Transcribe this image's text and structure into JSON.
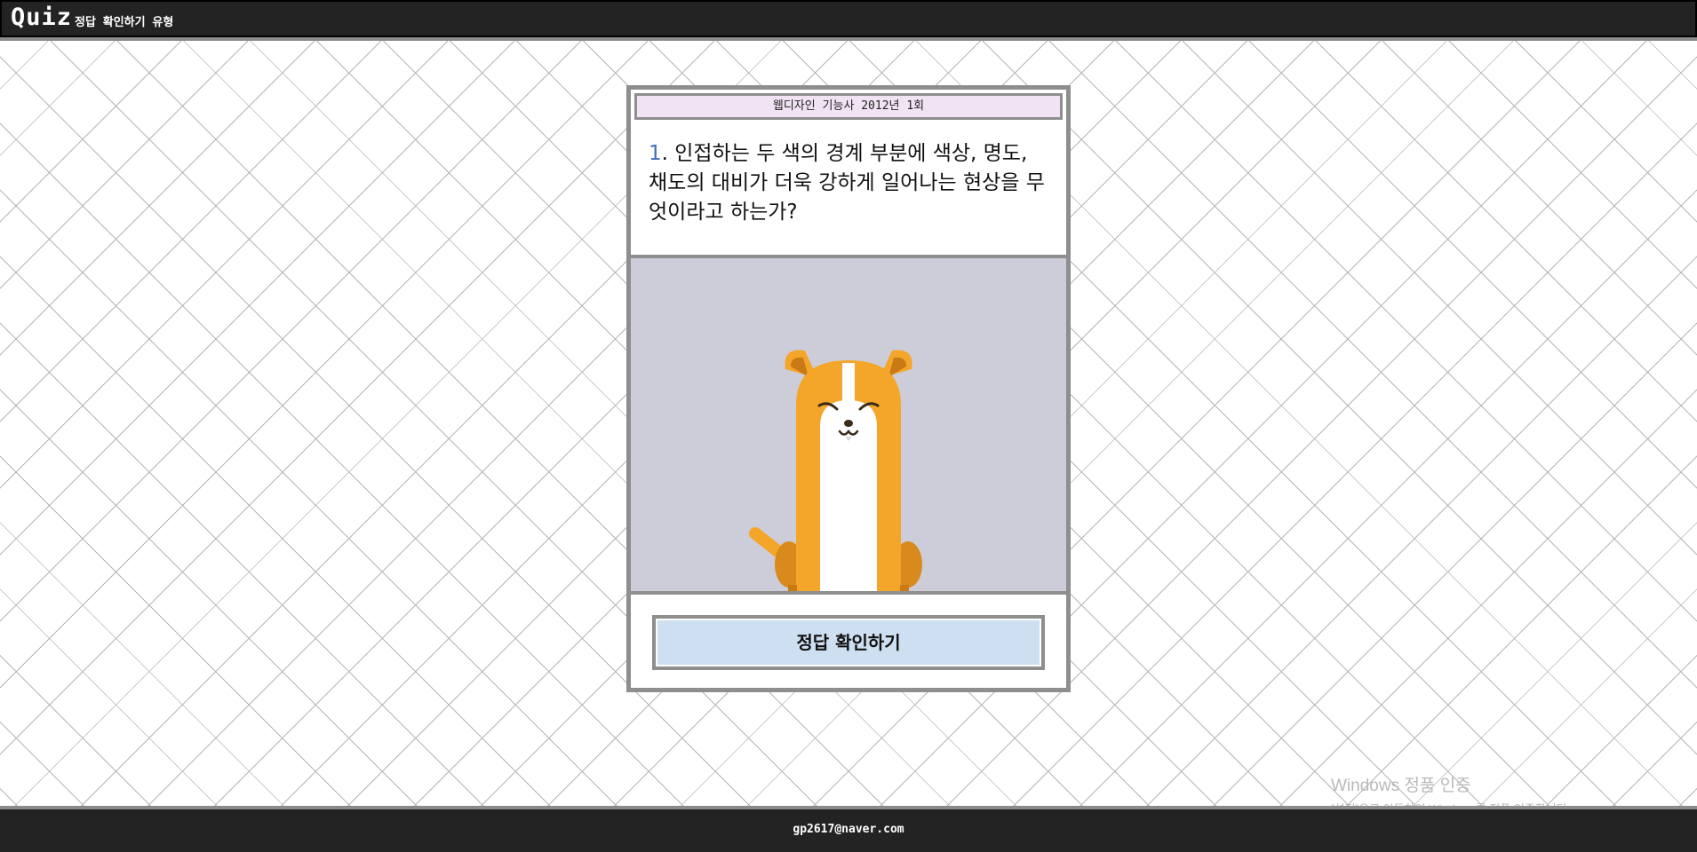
{
  "header": {
    "logo": "Quiz",
    "subtitle": "정답 확인하기 유형"
  },
  "quiz": {
    "category": "웹디자인 기능사 2012년 1회",
    "question_number": "1",
    "question_text": ". 인접하는 두 색의 경계 부분에 색상, 명도, 채도의 대비가 더욱 강하게 일어나는 현상을 무엇이라고 하는가?",
    "illustration": "dog-icon",
    "answer_button_label": "정답 확인하기"
  },
  "footer": {
    "email": "gp2617@naver.com"
  },
  "watermark": {
    "title": "Windows 정품 인증",
    "subtitle": "[설정]으로 이동하여 Windows를 정품 인증합니다."
  },
  "colors": {
    "bar_background": "#232323",
    "card_header_background": "#f1e2f4",
    "question_number": "#3c6fb8",
    "illustration_background": "#cdcdd9",
    "answer_button_background": "#cddff0",
    "dog_body": "#f4a62a"
  }
}
